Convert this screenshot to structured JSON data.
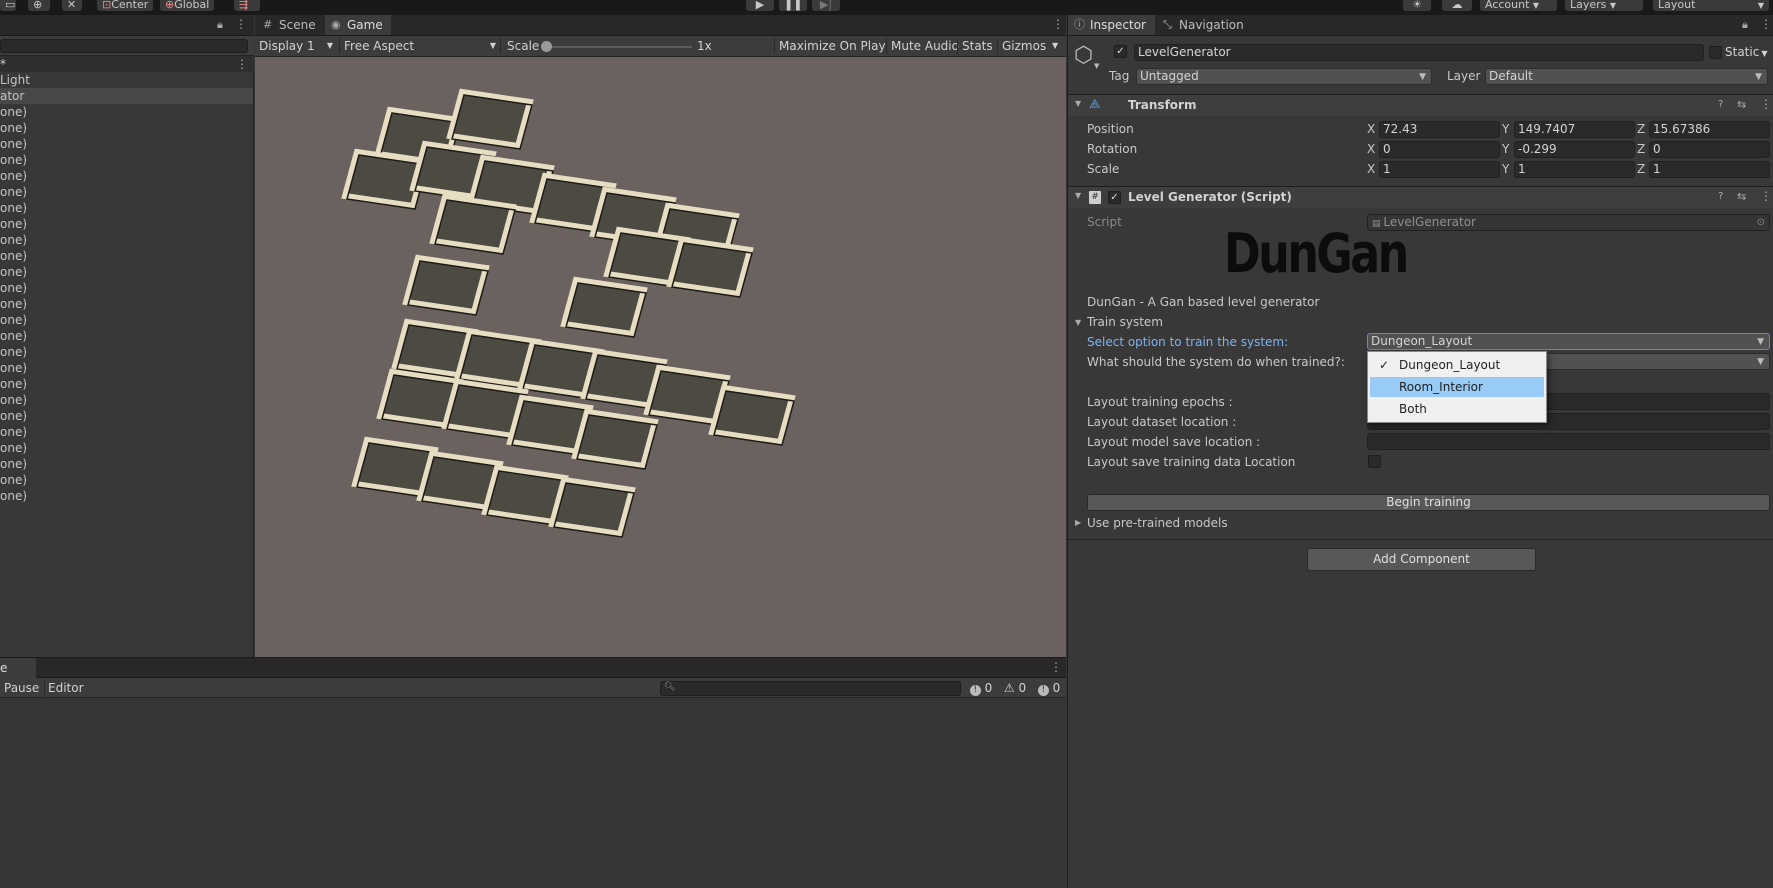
{
  "toolbar": {
    "pivot_label": "Center",
    "space_label": "Global",
    "play_icon": "play-icon",
    "pause_icon": "pause-icon",
    "step_icon": "step-icon",
    "account_label": "Account",
    "layers_label": "Layers",
    "layout_label": "Layout"
  },
  "hierarchy": {
    "partial_header": "*",
    "items": [
      "Light",
      "ator",
      "one)",
      "one)",
      "one)",
      "one)",
      "one)",
      "one)",
      "one)",
      "one)",
      "one)",
      "one)",
      "one)",
      "one)",
      "one)",
      "one)",
      "one)",
      "one)",
      "one)",
      "one)",
      "one)",
      "one)",
      "one)",
      "one)",
      "one)",
      "one)",
      "one)"
    ]
  },
  "game_view": {
    "tabs": [
      {
        "label": "Scene"
      },
      {
        "label": "Game"
      }
    ],
    "display_label": "Display 1",
    "aspect_label": "Free Aspect",
    "scale_label": "Scale",
    "scale_value": "1x",
    "maximize_label": "Maximize On Play",
    "mute_label": "Mute Audio",
    "stats_label": "Stats",
    "gizmos_label": "Gizmos"
  },
  "console": {
    "tab_label": "e",
    "pause_label": "Pause",
    "editor_label": "Editor",
    "errors_count": "0",
    "warnings_count": "0",
    "logs_count": "0"
  },
  "inspector": {
    "tabs": [
      {
        "label": "Inspector"
      },
      {
        "label": "Navigation"
      }
    ],
    "object_name": "LevelGenerator",
    "static_label": "Static",
    "tag_label": "Tag",
    "tag_value": "Untagged",
    "layer_label": "Layer",
    "layer_value": "Default",
    "transform": {
      "title": "Transform",
      "rows": [
        {
          "label": "Position",
          "x": "72.43",
          "y": "149.7407",
          "z": "15.67386"
        },
        {
          "label": "Rotation",
          "x": "0",
          "y": "-0.299",
          "z": "0"
        },
        {
          "label": "Scale",
          "x": "1",
          "y": "1",
          "z": "1"
        }
      ],
      "axis_x": "X",
      "axis_y": "Y",
      "axis_z": "Z"
    },
    "script_component": {
      "title": "Level Generator (Script)",
      "script_label": "Script",
      "script_value": "LevelGenerator",
      "logo_text": "DunGan",
      "description": "DunGan - A Gan based level generator",
      "train_foldout": "Train system",
      "select_option_label": "Select option to train the system:",
      "select_option_value": "Dungeon_Layout",
      "trained_label": "What should the system do when trained?:",
      "epochs_label": "Layout training epochs :",
      "dataset_label": "Layout dataset location :",
      "model_save_label": "Layout model save location :",
      "save_training_label": "Layout save training data Location",
      "begin_training_label": "Begin training",
      "pretrained_foldout": "Use pre-trained models"
    },
    "add_component_label": "Add Component",
    "dropdown_popup": {
      "options": [
        "Dungeon_Layout",
        "Room_Interior",
        "Both"
      ],
      "checked_option": "Dungeon_Layout",
      "highlighted_option": "Room_Interior"
    }
  },
  "colors": {
    "editor_bg": "#383838",
    "game_bg": "#6b625f",
    "highlight": "#98cbf6",
    "link_blue": "#7bb4f0"
  }
}
